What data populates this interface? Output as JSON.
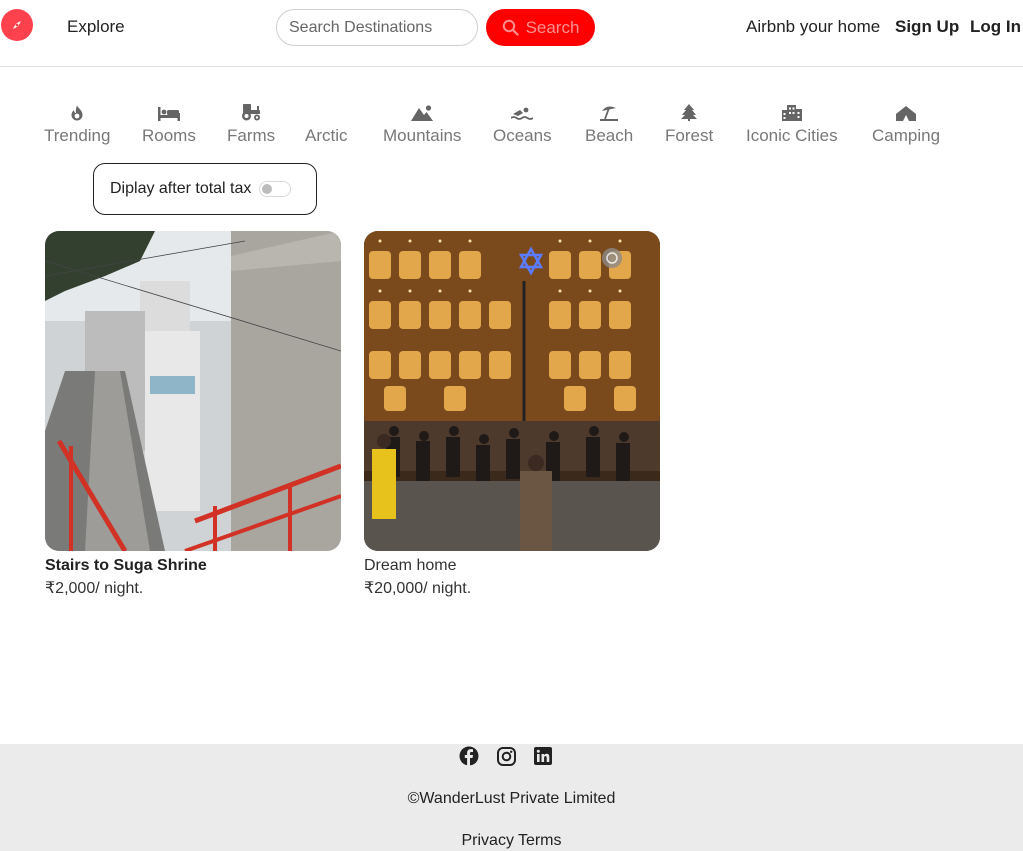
{
  "colors": {
    "brand": "#fe424d",
    "search_button": "#fe0000",
    "footer_bg": "#ebebeb"
  },
  "navbar": {
    "logo_icon": "compass-icon",
    "explore_label": "Explore",
    "search": {
      "placeholder": "Search Destinations",
      "button_label": "Search",
      "button_icon": "search-icon"
    },
    "airbnb_home_label": "Airbnb your home",
    "signup_label": "Sign Up",
    "login_label": "Log In"
  },
  "filters": [
    {
      "label": "Trending",
      "icon": "fire-icon"
    },
    {
      "label": "Rooms",
      "icon": "bed-icon"
    },
    {
      "label": "Farms",
      "icon": "tractor-icon"
    },
    {
      "label": "Arctic",
      "icon": "snowflake-icon"
    },
    {
      "label": "Mountains",
      "icon": "mountain-icon"
    },
    {
      "label": "Oceans",
      "icon": "swimmer-icon"
    },
    {
      "label": "Beach",
      "icon": "umbrella-beach-icon"
    },
    {
      "label": "Forest",
      "icon": "tree-icon"
    },
    {
      "label": "Iconic Cities",
      "icon": "city-icon"
    },
    {
      "label": "Camping",
      "icon": "campground-icon"
    }
  ],
  "tax_toggle": {
    "label": "Diplay after total tax",
    "enabled": false
  },
  "listings": [
    {
      "title": "Stairs to Suga Shrine",
      "price": "₹2,000",
      "per_night": "/ night."
    },
    {
      "title": "Dream home",
      "price": "₹20,000",
      "per_night": "/ night."
    }
  ],
  "footer": {
    "socials": [
      {
        "name": "facebook-icon"
      },
      {
        "name": "instagram-icon"
      },
      {
        "name": "linkedin-icon"
      }
    ],
    "copyright": "©WanderLust Private Limited",
    "links": [
      "Privacy",
      "Terms"
    ]
  }
}
